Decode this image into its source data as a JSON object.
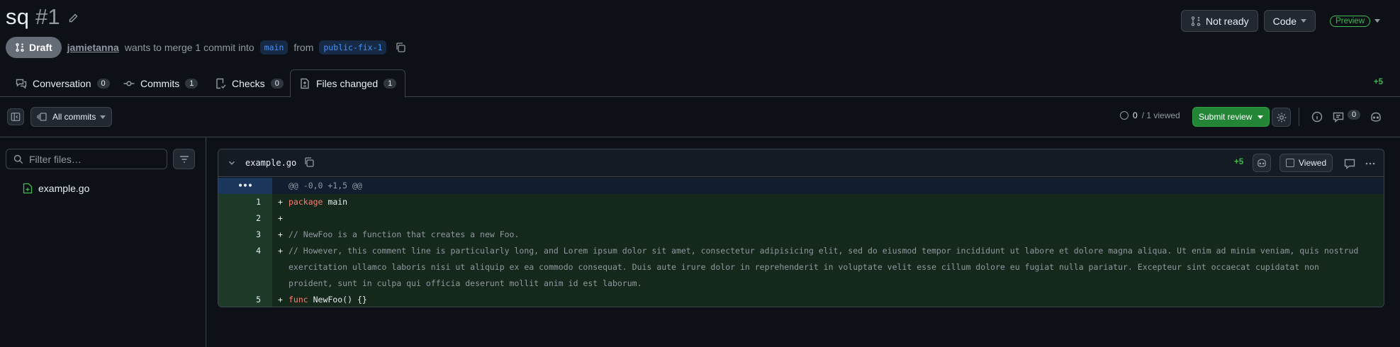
{
  "header": {
    "title": "sq",
    "number": "#1",
    "actions": {
      "not_ready": "Not ready",
      "code": "Code",
      "preview": "Preview"
    }
  },
  "meta": {
    "status": "Draft",
    "author": "jamietanna",
    "text_merge": "wants to merge 1 commit into",
    "base_branch": "main",
    "text_from": "from",
    "head_branch": "public-fix-1"
  },
  "tabs": [
    {
      "label": "Conversation",
      "count": "0"
    },
    {
      "label": "Commits",
      "count": "1"
    },
    {
      "label": "Checks",
      "count": "0"
    },
    {
      "label": "Files changed",
      "count": "1"
    }
  ],
  "additions_total": "+5",
  "toolbar": {
    "all_commits": "All commits",
    "viewed_num": "0",
    "viewed_text": "/ 1 viewed",
    "submit_review": "Submit review",
    "comments_count": "0"
  },
  "sidebar": {
    "filter_placeholder": "Filter files…",
    "files": [
      "example.go"
    ]
  },
  "diff": {
    "filename": "example.go",
    "additions": "+5",
    "viewed_label": "Viewed",
    "hunk_header": "@@ -0,0 +1,5 @@",
    "lines": [
      {
        "num": "1",
        "sign": "+",
        "kw": "package",
        "rest": " main"
      },
      {
        "num": "2",
        "sign": "+",
        "kw": "",
        "rest": ""
      },
      {
        "num": "3",
        "sign": "+",
        "comment": "// NewFoo is a function that creates a new Foo."
      },
      {
        "num": "4",
        "sign": "+",
        "comment": "// However, this comment line is particularly long, and Lorem ipsum dolor sit amet, consectetur adipisicing elit, sed do eiusmod tempor incididunt ut labore et dolore magna aliqua. Ut enim ad minim veniam, quis nostrud exercitation ullamco laboris nisi ut aliquip ex ea commodo consequat. Duis aute irure dolor in reprehenderit in voluptate velit esse cillum dolore eu fugiat nulla pariatur. Excepteur sint occaecat cupidatat non proident, sunt in culpa qui officia deserunt mollit anim id est laborum."
      },
      {
        "num": "5",
        "sign": "+",
        "kw": "func",
        "rest": " NewFoo() {}"
      }
    ]
  },
  "colors": {
    "background": "#0d1117",
    "accent_green": "#3fb950",
    "link_blue": "#4493f8",
    "submit_green": "#238636"
  }
}
